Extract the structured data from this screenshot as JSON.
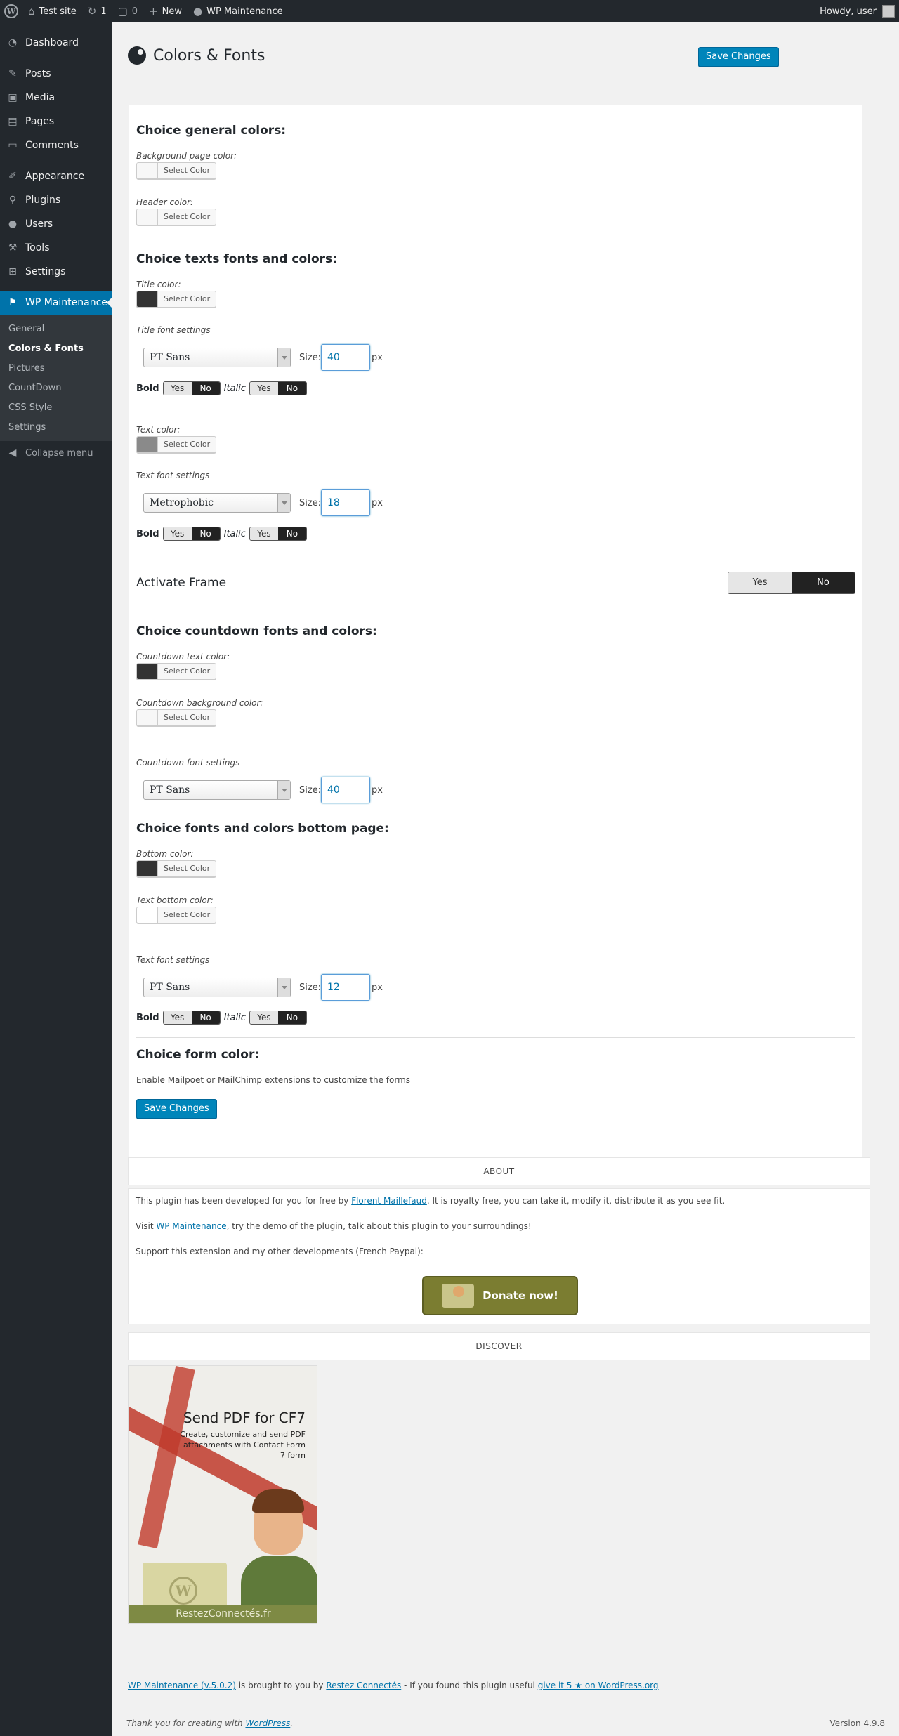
{
  "adminbar": {
    "site_name": "Test site",
    "updates": "1",
    "comments": "0",
    "new_label": "New",
    "plugin_label": "WP Maintenance",
    "howdy": "Howdy, user"
  },
  "sidebar": {
    "items": [
      {
        "label": "Dashboard",
        "icon": "dashboard-icon"
      },
      {
        "label": "Posts",
        "icon": "pin-icon"
      },
      {
        "label": "Media",
        "icon": "media-icon"
      },
      {
        "label": "Pages",
        "icon": "pages-icon"
      },
      {
        "label": "Comments",
        "icon": "comment-icon"
      },
      {
        "label": "Appearance",
        "icon": "brush-icon"
      },
      {
        "label": "Plugins",
        "icon": "plug-icon"
      },
      {
        "label": "Users",
        "icon": "user-icon"
      },
      {
        "label": "Tools",
        "icon": "wrench-icon"
      },
      {
        "label": "Settings",
        "icon": "settings-icon"
      },
      {
        "label": "WP Maintenance",
        "icon": "maintenance-icon"
      }
    ],
    "submenu": [
      "General",
      "Colors & Fonts",
      "Pictures",
      "CountDown",
      "CSS Style",
      "Settings"
    ],
    "collapse": "Collapse menu"
  },
  "page": {
    "title": "Colors & Fonts",
    "save_label": "Save Changes"
  },
  "form": {
    "general_title": "Choice general colors:",
    "bg_label": "Background page color:",
    "header_label": "Header color:",
    "select_color": "Select Color",
    "texts_title": "Choice texts fonts and colors:",
    "title_color_label": "Title color:",
    "title_font_label": "Title font settings",
    "title_font": "PT Sans",
    "title_size": "40",
    "size_label": "Size:",
    "px": "px",
    "bold": "Bold",
    "italic": "Italic",
    "yes": "Yes",
    "no": "No",
    "text_color_label": "Text color:",
    "text_font_label": "Text font settings",
    "text_font": "Metrophobic",
    "text_size": "18",
    "frame_label": "Activate Frame",
    "countdown_title": "Choice countdown fonts and colors:",
    "countdown_text_label": "Countdown text color:",
    "countdown_bg_label": "Countdown background color:",
    "countdown_font_label": "Countdown font settings",
    "countdown_font": "PT Sans",
    "countdown_size": "40",
    "bottom_title": "Choice fonts and colors bottom page:",
    "bottom_color_label": "Bottom color:",
    "text_bottom_label": "Text bottom color:",
    "bottom_font_label": "Text font settings",
    "bottom_font": "PT Sans",
    "bottom_size": "12",
    "form_title": "Choice form color:",
    "form_note": "Enable Mailpoet or MailChimp extensions to customize the forms"
  },
  "about": {
    "heading": "ABOUT",
    "line1_a": "This plugin has been developed for you for free by ",
    "line1_link": "Florent Maillefaud",
    "line1_b": ". It is royalty free, you can take it, modify it, distribute it as you see fit.",
    "line2_a": "Visit ",
    "line2_link": "WP Maintenance",
    "line2_b": ", try the demo of the plugin, talk about this plugin to your surroundings!",
    "line3": "Support this extension and my other developments (French Paypal):",
    "donate": "Donate now!"
  },
  "discover": {
    "heading": "DISCOVER",
    "banner_title": "Send PDF for CF7",
    "banner_sub": "Create, customize and send PDF attachments with Contact Form 7 form",
    "banner_footer": "RestezConnectés.fr"
  },
  "footer": {
    "plugin_link": "WP Maintenance (v.5.0.2)",
    "brought": " is brought to you by ",
    "author_link": "Restez Connectés",
    "found": " - If you found this plugin useful ",
    "rate_link": "give it 5 ★ on WordPress.org",
    "thanks_a": "Thank you for creating with ",
    "thanks_link": "WordPress",
    "thanks_b": ".",
    "version": "Version 4.9.8"
  },
  "colors": {
    "accent": "#0085ba",
    "sidebar_bg": "#23282d",
    "dark_swatch": "#333333",
    "grey_swatch": "#8a8a8a",
    "light_swatch": "#f7f7f7"
  }
}
